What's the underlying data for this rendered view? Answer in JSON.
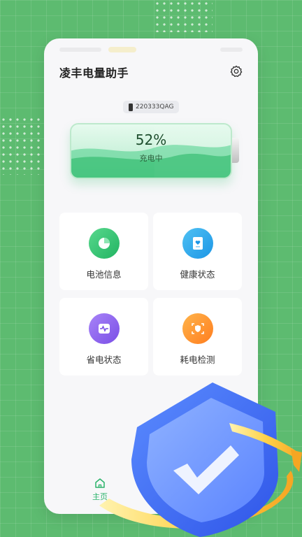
{
  "header": {
    "app_title": "凌丰电量助手",
    "settings_icon": "gear-icon"
  },
  "device": {
    "model": "220333QAG",
    "icon": "phone-icon"
  },
  "battery": {
    "percent_text": "52%",
    "level": 0.52,
    "status": "充电中",
    "accent_color": "#2ec777"
  },
  "features": [
    {
      "label": "电池信息",
      "icon": "pie-chart-icon",
      "color": "#22b462"
    },
    {
      "label": "健康状态",
      "icon": "clipboard-heart-icon",
      "color": "#1c96e6"
    },
    {
      "label": "省电状态",
      "icon": "pulse-icon",
      "color": "#7a4ee6"
    },
    {
      "label": "耗电检测",
      "icon": "scan-shield-icon",
      "color": "#ff7d1f"
    }
  ],
  "tabbar": {
    "home_label": "主页",
    "home_icon": "home-icon",
    "active_color": "#2bb36b"
  }
}
